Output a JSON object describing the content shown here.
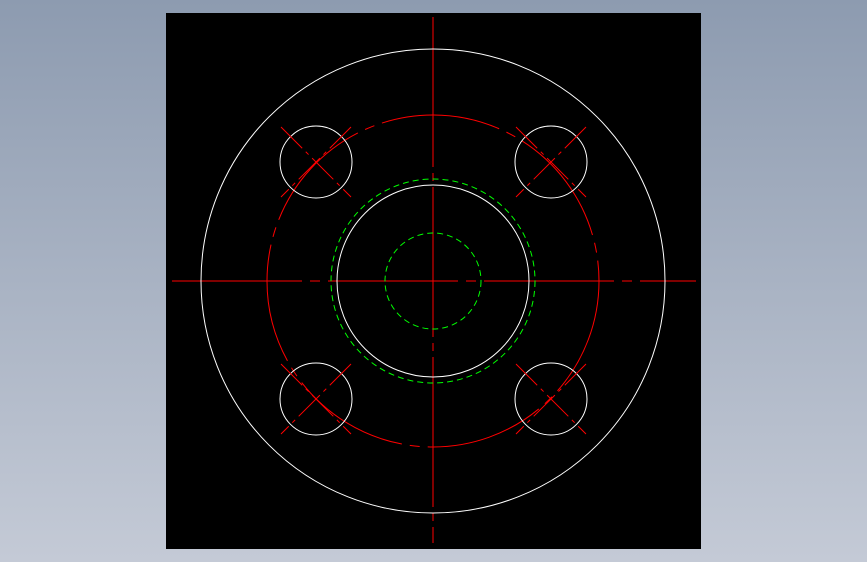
{
  "viewer": {
    "background_color": "#000000",
    "page_gradient": [
      "#8d9bb0",
      "#c4cad6"
    ]
  },
  "drawing": {
    "type": "flange-top-view",
    "bolt_hole_count": 4,
    "layers": {
      "outline": {
        "color": "#ffffff",
        "linetype": "continuous"
      },
      "centerline": {
        "color": "#ff0000",
        "linetype": "dash-dot"
      },
      "hidden": {
        "color": "#00ff00",
        "linetype": "dashed"
      }
    }
  }
}
